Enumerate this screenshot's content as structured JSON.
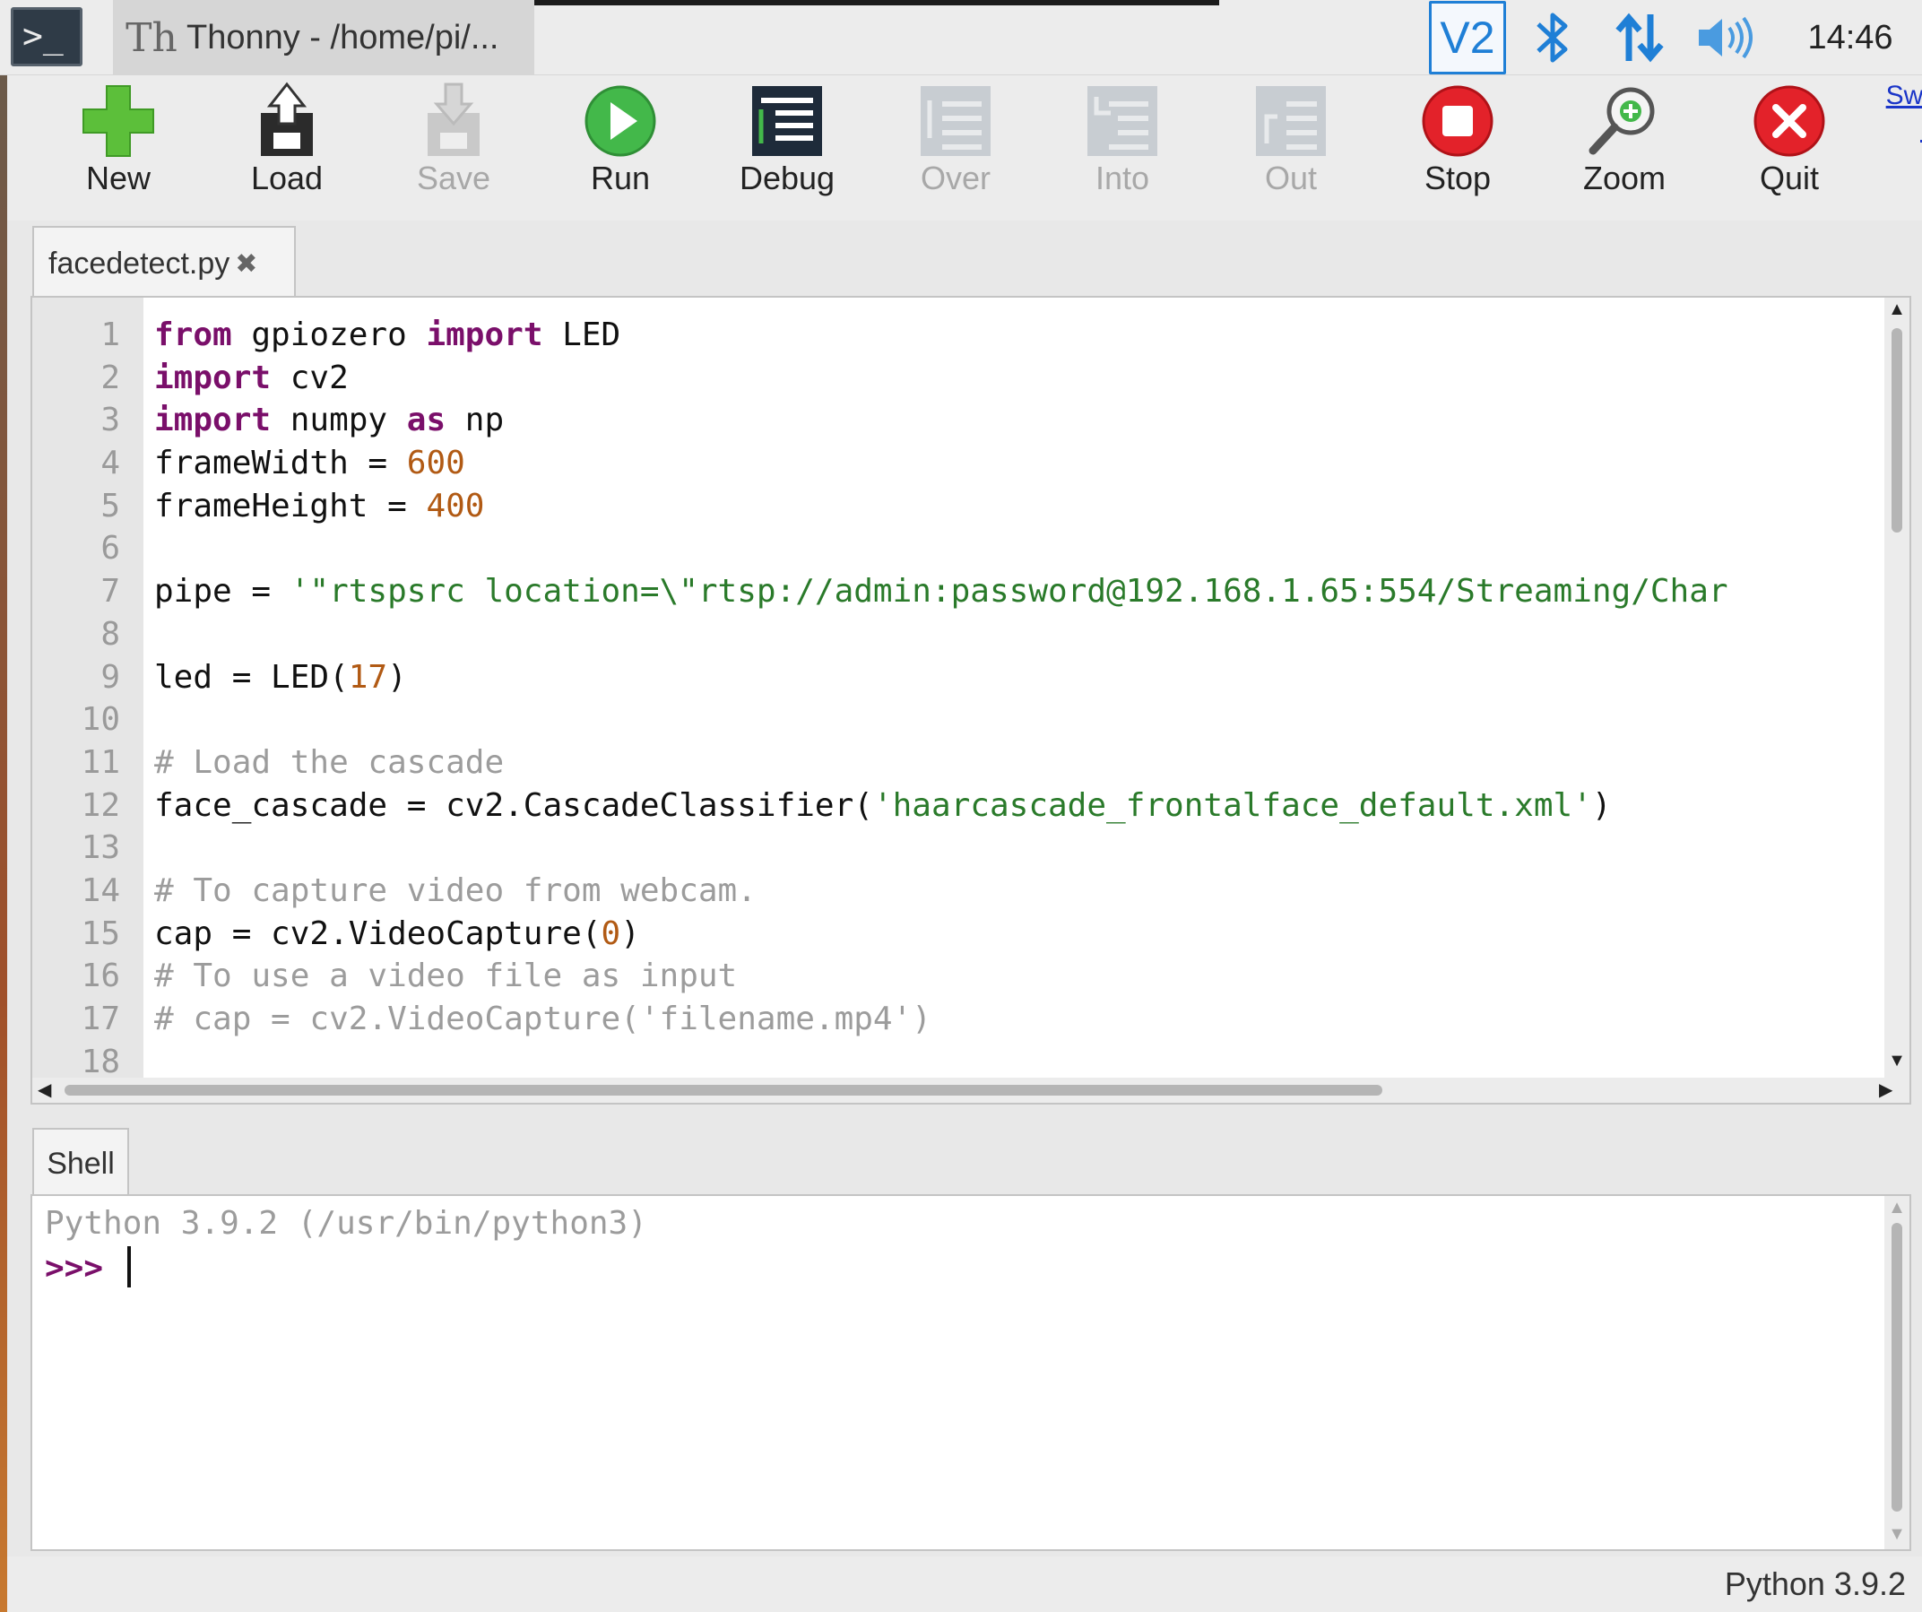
{
  "taskbar": {
    "terminal_label": ">_",
    "app_title": "Thonny  -  /home/pi/...",
    "clock": "14:46",
    "icons": [
      "terminal-icon",
      "thonny-icon",
      "vnc-icon",
      "bluetooth-icon",
      "network-icon",
      "volume-icon"
    ]
  },
  "toolbar": {
    "buttons": [
      {
        "label": "New",
        "icon": "new-icon",
        "enabled": true
      },
      {
        "label": "Load",
        "icon": "load-icon",
        "enabled": true
      },
      {
        "label": "Save",
        "icon": "save-icon",
        "enabled": false
      },
      {
        "label": "Run",
        "icon": "run-icon",
        "enabled": true
      },
      {
        "label": "Debug",
        "icon": "debug-icon",
        "enabled": true
      },
      {
        "label": "Over",
        "icon": "step-over-icon",
        "enabled": false
      },
      {
        "label": "Into",
        "icon": "step-into-icon",
        "enabled": false
      },
      {
        "label": "Out",
        "icon": "step-out-icon",
        "enabled": false
      },
      {
        "label": "Stop",
        "icon": "stop-icon",
        "enabled": true
      },
      {
        "label": "Zoom",
        "icon": "zoom-icon",
        "enabled": true
      },
      {
        "label": "Quit",
        "icon": "quit-icon",
        "enabled": true
      }
    ],
    "switch_link": "Swi\nr"
  },
  "editor": {
    "tab_label": "facedetect.py",
    "close_glyph": "✖",
    "line_numbers": [
      "1",
      "2",
      "3",
      "4",
      "5",
      "6",
      "7",
      "8",
      "9",
      "10",
      "11",
      "12",
      "13",
      "14",
      "15",
      "16",
      "17",
      "18"
    ],
    "lines": [
      [
        {
          "t": "from",
          "c": "kw"
        },
        {
          "t": " gpiozero "
        },
        {
          "t": "import",
          "c": "kw"
        },
        {
          "t": " LED"
        }
      ],
      [
        {
          "t": "import",
          "c": "kw"
        },
        {
          "t": " cv2"
        }
      ],
      [
        {
          "t": "import",
          "c": "kw"
        },
        {
          "t": " numpy "
        },
        {
          "t": "as",
          "c": "kw"
        },
        {
          "t": " np"
        }
      ],
      [
        {
          "t": "frameWidth = "
        },
        {
          "t": "600",
          "c": "num"
        }
      ],
      [
        {
          "t": "frameHeight = "
        },
        {
          "t": "400",
          "c": "num"
        }
      ],
      [],
      [
        {
          "t": "pipe = "
        },
        {
          "t": "'\"rtspsrc location=\\\"rtsp://admin:password@192.168.1.65:554/Streaming/Char",
          "c": "str"
        }
      ],
      [],
      [
        {
          "t": "led = LED("
        },
        {
          "t": "17",
          "c": "num"
        },
        {
          "t": ")"
        }
      ],
      [],
      [
        {
          "t": "# Load the cascade",
          "c": "cmt"
        }
      ],
      [
        {
          "t": "face_cascade = cv2.CascadeClassifier("
        },
        {
          "t": "'haarcascade_frontalface_default.xml'",
          "c": "str"
        },
        {
          "t": ")"
        }
      ],
      [],
      [
        {
          "t": "# To capture video from webcam.",
          "c": "cmt"
        }
      ],
      [
        {
          "t": "cap = cv2.VideoCapture("
        },
        {
          "t": "0",
          "c": "num"
        },
        {
          "t": ")"
        }
      ],
      [
        {
          "t": "# To use a video file as input",
          "c": "cmt"
        }
      ],
      [
        {
          "t": "# cap = cv2.VideoCapture('filename.mp4')",
          "c": "cmt"
        }
      ],
      []
    ]
  },
  "shell": {
    "tab_label": "Shell",
    "banner": "Python 3.9.2 (/usr/bin/python3)",
    "prompt": ">>>"
  },
  "status": {
    "interpreter": "Python 3.9.2"
  },
  "colors": {
    "keyword": "#7a0f6a",
    "number": "#b15a14",
    "string": "#2a7a2a",
    "comment": "#9c9c9c",
    "accent_blue": "#1f7fd6"
  }
}
